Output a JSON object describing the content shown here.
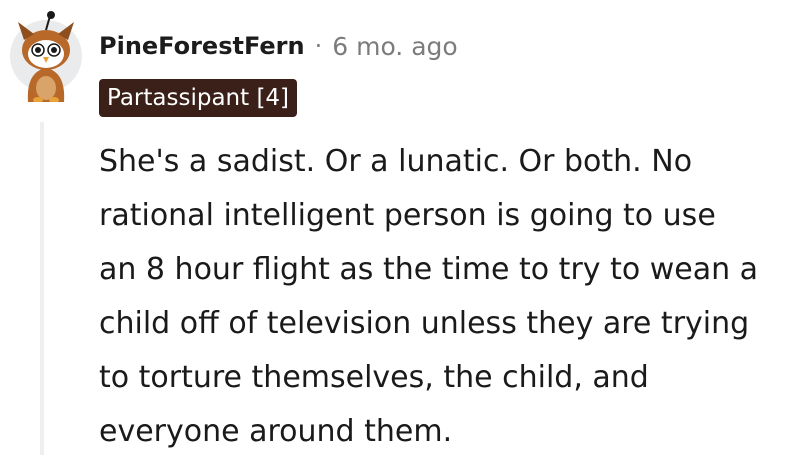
{
  "comment": {
    "author": "PineForestFern",
    "separator": "·",
    "timestamp": "6 mo. ago",
    "flair": "Partassipant [4]",
    "flair_color": "#3a2019",
    "avatar_icon": "owl-snoo-avatar-icon",
    "body": "She's a sadist. Or a lunatic. Or both. No rational intelligent person is going to use an 8 hour flight as the time to try to wean a child off of television unless they are trying to torture themselves, the child, and everyone around them."
  }
}
